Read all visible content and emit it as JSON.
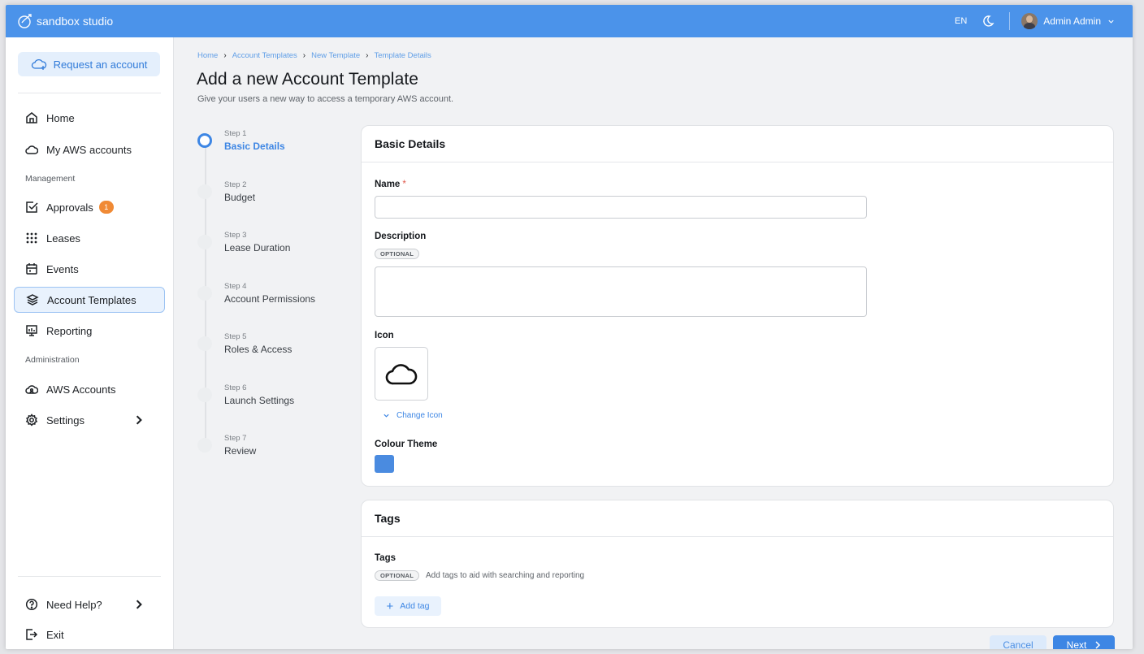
{
  "app": {
    "brand": "sandbox studio",
    "language": "EN",
    "user_name": "Admin Admin"
  },
  "sidebar": {
    "request_label": "Request an account",
    "items": [
      {
        "label": "Home",
        "icon": "home-icon"
      },
      {
        "label": "My AWS accounts",
        "icon": "cloud-icon"
      },
      {
        "label": "Approvals",
        "icon": "checkbox-icon",
        "badge": "1"
      },
      {
        "label": "Leases",
        "icon": "grid-dots-icon"
      },
      {
        "label": "Events",
        "icon": "calendar-icon"
      },
      {
        "label": "Account Templates",
        "icon": "layers-icon",
        "active": true
      },
      {
        "label": "Reporting",
        "icon": "presentation-icon"
      },
      {
        "label": "AWS Accounts",
        "icon": "cloud-user-icon"
      },
      {
        "label": "Settings",
        "icon": "gear-icon"
      }
    ],
    "sections": {
      "management": "Management",
      "administration": "Administration"
    },
    "footer": {
      "help": "Need Help?",
      "exit": "Exit"
    }
  },
  "breadcrumb": [
    "Home",
    "Account Templates",
    "New Template",
    "Template Details"
  ],
  "page": {
    "title": "Add a new Account Template",
    "subtitle": "Give your users a new way to access a temporary AWS account."
  },
  "steps": [
    {
      "num": "Step 1",
      "label": "Basic Details",
      "active": true
    },
    {
      "num": "Step 2",
      "label": "Budget"
    },
    {
      "num": "Step 3",
      "label": "Lease Duration"
    },
    {
      "num": "Step 4",
      "label": "Account Permissions"
    },
    {
      "num": "Step 5",
      "label": "Roles & Access"
    },
    {
      "num": "Step 6",
      "label": "Launch Settings"
    },
    {
      "num": "Step 7",
      "label": "Review"
    }
  ],
  "basic_details": {
    "header": "Basic Details",
    "name_label": "Name",
    "required_mark": "*",
    "name_value": "",
    "description_label": "Description",
    "optional_pill": "OPTIONAL",
    "description_value": "",
    "icon_label": "Icon",
    "selected_icon": "cloud-icon",
    "change_icon": "Change Icon",
    "colour_label": "Colour Theme",
    "colour_value": "#4a8be0"
  },
  "tags": {
    "header": "Tags",
    "label": "Tags",
    "optional_pill": "OPTIONAL",
    "hint": "Add tags to aid with searching and reporting",
    "add_tag": "Add tag"
  },
  "actions": {
    "cancel": "Cancel",
    "next": "Next"
  }
}
